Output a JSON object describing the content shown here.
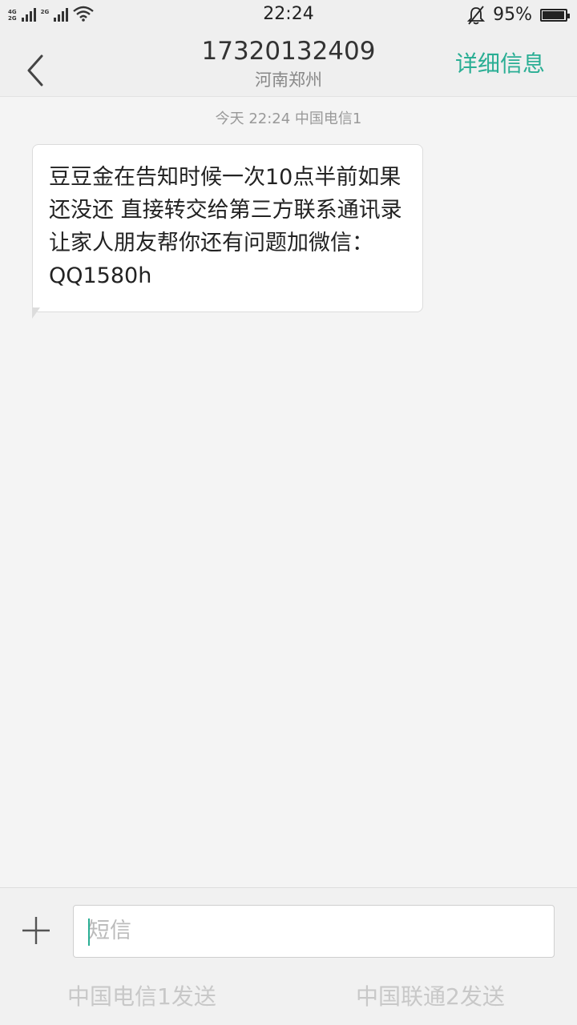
{
  "status_bar": {
    "network_top": "4G",
    "network_bottom": "2G",
    "network_secondary": "2G",
    "time": "22:24",
    "battery": "95%",
    "battery_level": 0.95,
    "icons": [
      "signal-icon",
      "wifi-icon",
      "mute-bell-icon",
      "battery-icon"
    ]
  },
  "header": {
    "back_icon": "chevron-left-icon",
    "contact_number": "17320132409",
    "contact_location": "河南郑州",
    "details_label": "详细信息",
    "accent_color": "#2aae94"
  },
  "conversation": {
    "timestamp": "今天  22:24  中国电信1",
    "messages": [
      {
        "direction": "incoming",
        "text": "豆豆金在告知时候一次10点半前如果还没还 直接转交给第三方联系通讯录让家人朋友帮你还有问题加微信：QQ1580h"
      }
    ]
  },
  "composer": {
    "add_icon": "plus-icon",
    "placeholder": "短信",
    "send_sim1": "中国电信1发送",
    "send_sim2": "中国联通2发送"
  }
}
